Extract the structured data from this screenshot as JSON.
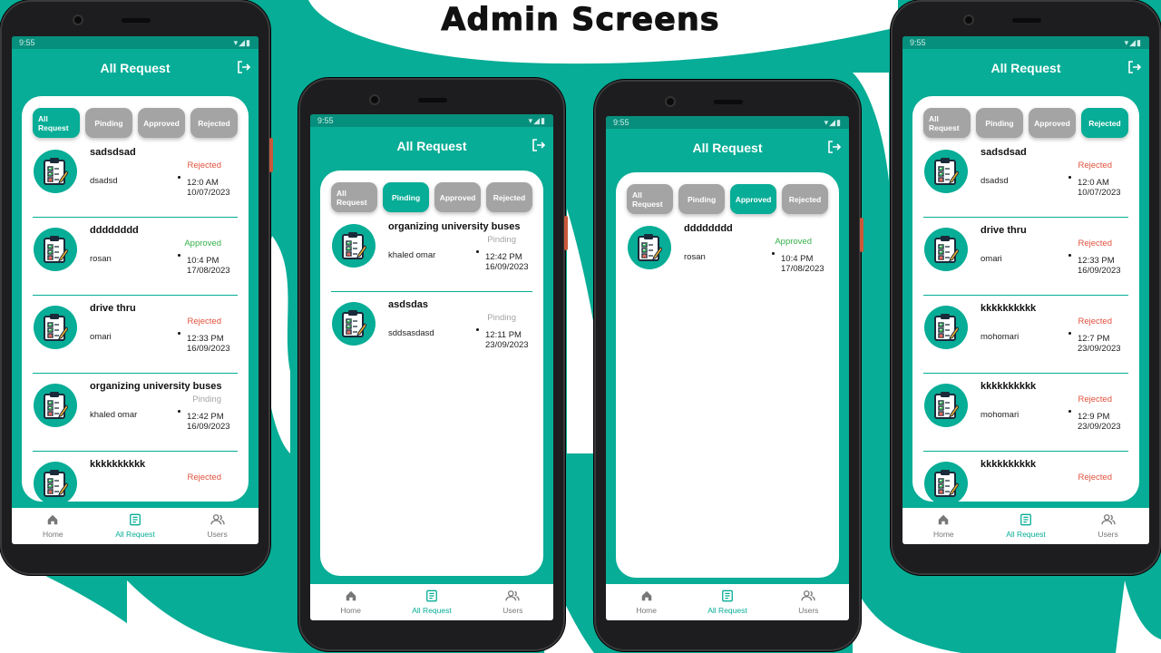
{
  "page_title": "Admin Screens",
  "colors": {
    "teal": "#07ad96",
    "rejected": "#e1513e",
    "approved": "#35b14a",
    "pending": "#a4a4a4"
  },
  "phones": [
    {
      "status_time": "9:55",
      "header_title": "All Request",
      "chips": [
        "All Request",
        "Pinding",
        "Approved",
        "Rejected"
      ],
      "active_chip": 0,
      "requests": [
        {
          "title": "sadsdsad",
          "status": "Rejected",
          "user": "dsadsd",
          "time": "12:0 AM",
          "date": "10/07/2023"
        },
        {
          "title": "dddddddd",
          "status": "Approved",
          "user": "rosan",
          "time": "10:4 PM",
          "date": "17/08/2023"
        },
        {
          "title": "drive thru",
          "status": "Rejected",
          "user": "omari",
          "time": "12:33 PM",
          "date": "16/09/2023"
        },
        {
          "title": "organizing university buses",
          "status": "Pinding",
          "user": "khaled omar",
          "time": "12:42 PM",
          "date": "16/09/2023"
        },
        {
          "title": "kkkkkkkkkk",
          "status": "Rejected",
          "user": "",
          "time": "",
          "date": ""
        }
      ],
      "nav": [
        "Home",
        "All Request",
        "Users"
      ],
      "active_nav": 1
    },
    {
      "status_time": "9:55",
      "header_title": "All Request",
      "chips": [
        "All Request",
        "Pinding",
        "Approved",
        "Rejected"
      ],
      "active_chip": 1,
      "requests": [
        {
          "title": "organizing university buses",
          "status": "Pinding",
          "user": "khaled omar",
          "time": "12:42 PM",
          "date": "16/09/2023"
        },
        {
          "title": "asdsdas",
          "status": "Pinding",
          "user": "sddsasdasd",
          "time": "12:11 PM",
          "date": "23/09/2023"
        }
      ],
      "nav": [
        "Home",
        "All Request",
        "Users"
      ],
      "active_nav": 1
    },
    {
      "status_time": "9:55",
      "header_title": "All Request",
      "chips": [
        "All Request",
        "Pinding",
        "Approved",
        "Rejected"
      ],
      "active_chip": 2,
      "requests": [
        {
          "title": "dddddddd",
          "status": "Approved",
          "user": "rosan",
          "time": "10:4 PM",
          "date": "17/08/2023"
        }
      ],
      "nav": [
        "Home",
        "All Request",
        "Users"
      ],
      "active_nav": 1
    },
    {
      "status_time": "9:55",
      "header_title": "All Request",
      "chips": [
        "All Request",
        "Pinding",
        "Approved",
        "Rejected"
      ],
      "active_chip": 3,
      "requests": [
        {
          "title": "sadsdsad",
          "status": "Rejected",
          "user": "dsadsd",
          "time": "12:0 AM",
          "date": "10/07/2023"
        },
        {
          "title": "drive thru",
          "status": "Rejected",
          "user": "omari",
          "time": "12:33 PM",
          "date": "16/09/2023"
        },
        {
          "title": "kkkkkkkkkk",
          "status": "Rejected",
          "user": "mohomari",
          "time": "12:7 PM",
          "date": "23/09/2023"
        },
        {
          "title": "kkkkkkkkkk",
          "status": "Rejected",
          "user": "mohomari",
          "time": "12:9 PM",
          "date": "23/09/2023"
        },
        {
          "title": "kkkkkkkkkk",
          "status": "Rejected",
          "user": "",
          "time": "",
          "date": ""
        }
      ],
      "nav": [
        "Home",
        "All Request",
        "Users"
      ],
      "active_nav": 1
    }
  ]
}
